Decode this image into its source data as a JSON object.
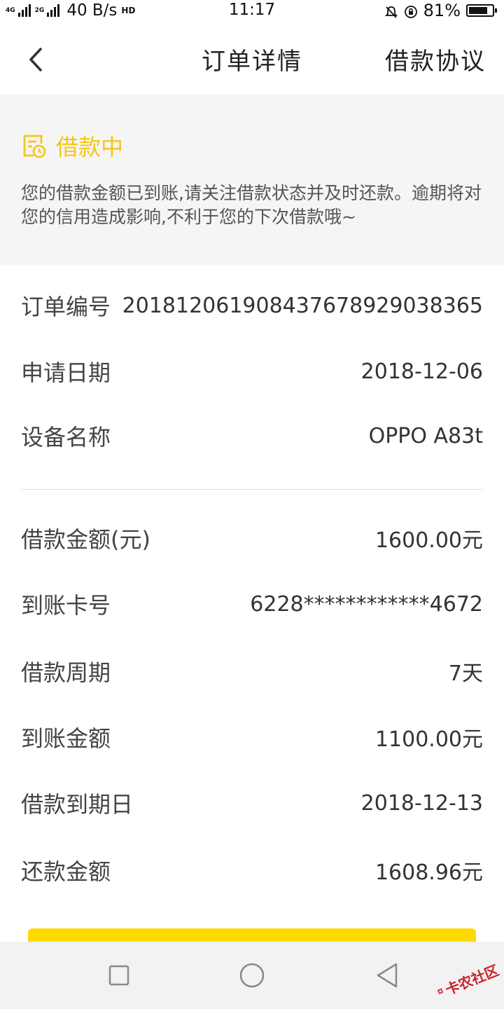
{
  "status_bar": {
    "network1": "4G",
    "network2": "2G",
    "speed": "40 B/s",
    "hd": "HD",
    "time": "11:17",
    "battery": "81%",
    "battery_level": 0.81
  },
  "header": {
    "title": "订单详情",
    "right_link": "借款协议"
  },
  "status": {
    "label": "借款中",
    "description": "您的借款金额已到账,请关注借款状态并及时还款。逾期将对您的信用造成影响,不利于您的下次借款哦~",
    "accent_color": "#f7c519"
  },
  "order": {
    "rows": [
      {
        "key": "订单编号",
        "value": "20181206190843767892903836​5"
      },
      {
        "key": "申请日期",
        "value": "2018-12-06"
      },
      {
        "key": "设备名称",
        "value": "OPPO A83t"
      }
    ]
  },
  "loan": {
    "rows": [
      {
        "key": "借款金额(元)",
        "value": "1600.00元"
      },
      {
        "key": "到账卡号",
        "value": "6228************4672"
      },
      {
        "key": "借款周期",
        "value": "7天"
      },
      {
        "key": "到账金额",
        "value": "1100.00元"
      },
      {
        "key": "借款到期日",
        "value": "2018-12-13"
      },
      {
        "key": "还款金额",
        "value": "1608.96元"
      }
    ]
  },
  "action_color": "#ffd900",
  "watermark": "卡农社区"
}
